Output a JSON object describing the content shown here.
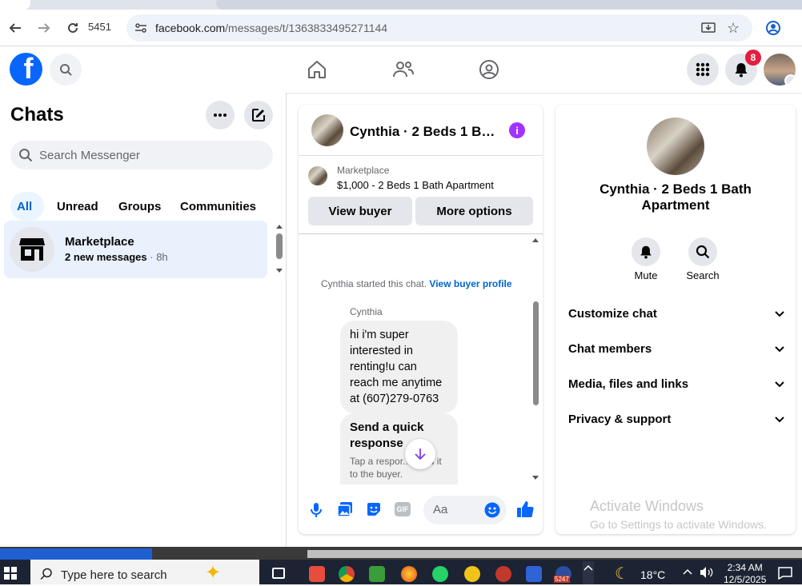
{
  "browser": {
    "tab_count": "5451",
    "url_host": "facebook.com",
    "url_path": "/messages/t/1363833495271144"
  },
  "header": {
    "notifications_count": "8"
  },
  "chats": {
    "title": "Chats",
    "search_placeholder": "Search Messenger",
    "filters": [
      "All",
      "Unread",
      "Groups",
      "Communities"
    ],
    "items": [
      {
        "name": "Marketplace",
        "subtitle": "2 new messages",
        "time": "8h"
      }
    ]
  },
  "conversation": {
    "title": "Cynthia · 2 Beds 1 Bath Apartment",
    "marketplace_label": "Marketplace",
    "listing": "$1,000 - 2 Beds 1 Bath Apartment",
    "view_buyer": "View buyer",
    "more_options": "More options",
    "started_text": "Cynthia started this chat.",
    "view_buyer_profile": "View buyer profile",
    "sender": "Cynthia",
    "message": "hi i'm super interested in renting!u can reach me anytime at  (607)279-0763",
    "quick_title": "Send a quick response",
    "quick_sub": "Tap a respor... send it to the buyer.",
    "composer_placeholder": "Aa"
  },
  "info": {
    "title": "Cynthia · 2 Beds 1 Bath Apartment",
    "actions": [
      "Mute",
      "Search"
    ],
    "sections": [
      "Customize chat",
      "Chat members",
      "Media, files and links",
      "Privacy & support"
    ]
  },
  "watermark": {
    "line1": "Activate Windows",
    "line2": "Go to Settings to activate Windows."
  },
  "taskbar": {
    "search_placeholder": "Type here to search",
    "temperature": "18°C",
    "time": "2:34 AM",
    "date": "12/5/2025",
    "badge": "5247"
  },
  "colors": {
    "facebook_blue": "#0866ff",
    "messenger_purple": "#a033ff",
    "link_blue": "#0064d1",
    "notification_red": "#e41e3f"
  }
}
